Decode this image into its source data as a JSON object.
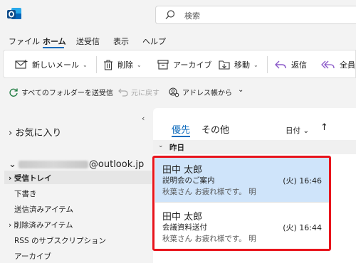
{
  "titlebar": {
    "search_placeholder": "検索",
    "app_icon": "outlook-icon"
  },
  "menu": {
    "tabs": [
      "ファイル",
      "ホーム",
      "送受信",
      "表示",
      "ヘルプ"
    ],
    "active": "ホーム"
  },
  "ribbon": {
    "new_mail": "新しいメール",
    "delete": "削除",
    "archive": "アーカイブ",
    "move": "移動",
    "reply": "返信",
    "reply_all": "全員"
  },
  "toolbar2": {
    "sync_all": "すべてのフォルダーを送受信",
    "undo": "元に戻す",
    "address_book": "アドレス帳から"
  },
  "folders": {
    "favorites": "お気に入り",
    "account_suffix": "@outlook.jp",
    "items": [
      {
        "label": "受信トレイ",
        "prefix": "›",
        "selected": true
      },
      {
        "label": "下書き",
        "prefix": "",
        "selected": false
      },
      {
        "label": "送信済みアイテム",
        "prefix": "",
        "selected": false
      },
      {
        "label": "削除済みアイテム",
        "prefix": "›",
        "selected": false
      },
      {
        "label": "RSS のサブスクリプション",
        "prefix": "",
        "selected": false
      },
      {
        "label": "アーカイブ",
        "prefix": "",
        "selected": false
      }
    ]
  },
  "message_list": {
    "tab_focused": "優先",
    "tab_other": "その他",
    "filter_label": "日付",
    "group_label": "昨日",
    "messages": [
      {
        "sender": "田中 太郎",
        "subject": "説明会のご案内",
        "time": "(火) 16:46",
        "preview": "秋葉さん お疲れ様です。 明"
      },
      {
        "sender": "田中 太郎",
        "subject": "会議資料送付",
        "time": "(火) 16:44",
        "preview": "秋葉さん お疲れ様です。 明"
      }
    ]
  },
  "colors": {
    "accent": "#0f6cbd",
    "selected_mail": "#cfe4fa",
    "highlight": "#e8141c"
  }
}
